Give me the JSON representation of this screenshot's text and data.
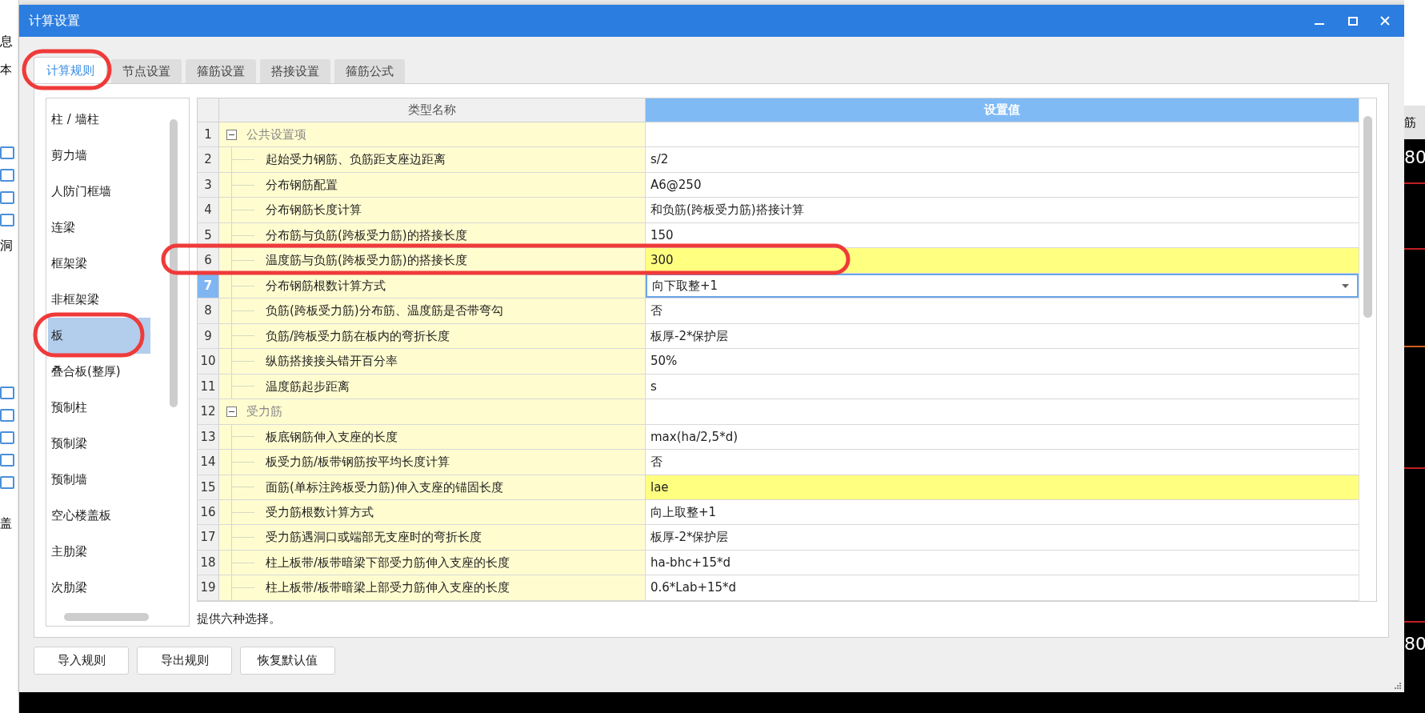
{
  "background": {
    "left_labels": [
      "息",
      "本",
      "洞",
      "盖"
    ],
    "right_labels": [
      "筋",
      "80",
      "80"
    ]
  },
  "window": {
    "title": "计算设置"
  },
  "tabs": [
    {
      "label": "计算规则",
      "selected": true
    },
    {
      "label": "节点设置",
      "selected": false
    },
    {
      "label": "箍筋设置",
      "selected": false
    },
    {
      "label": "搭接设置",
      "selected": false
    },
    {
      "label": "箍筋公式",
      "selected": false
    }
  ],
  "categories": [
    {
      "label": "柱 / 墙柱",
      "selected": false
    },
    {
      "label": "剪力墙",
      "selected": false
    },
    {
      "label": "人防门框墙",
      "selected": false
    },
    {
      "label": "连梁",
      "selected": false
    },
    {
      "label": "框架梁",
      "selected": false
    },
    {
      "label": "非框架梁",
      "selected": false
    },
    {
      "label": "板",
      "selected": true
    },
    {
      "label": "叠合板(整厚)",
      "selected": false
    },
    {
      "label": "预制柱",
      "selected": false
    },
    {
      "label": "预制梁",
      "selected": false
    },
    {
      "label": "预制墙",
      "selected": false
    },
    {
      "label": "空心楼盖板",
      "selected": false
    },
    {
      "label": "主肋梁",
      "selected": false
    },
    {
      "label": "次肋梁",
      "selected": false
    }
  ],
  "table": {
    "columns": [
      "类型名称",
      "设置值"
    ],
    "rows": [
      {
        "num": "1",
        "kind": "group",
        "name": "公共设置项",
        "expanded": true
      },
      {
        "num": "2",
        "kind": "item",
        "name": "起始受力钢筋、负筋距支座边距离",
        "value": "s/2",
        "highlighted": false,
        "selected": false
      },
      {
        "num": "3",
        "kind": "item",
        "name": "分布钢筋配置",
        "value": "A6@250",
        "highlighted": false,
        "selected": false
      },
      {
        "num": "4",
        "kind": "item",
        "name": "分布钢筋长度计算",
        "value": "和负筋(跨板受力筋)搭接计算",
        "highlighted": false,
        "selected": false
      },
      {
        "num": "5",
        "kind": "item",
        "name": "分布筋与负筋(跨板受力筋)的搭接长度",
        "value": "150",
        "highlighted": false,
        "selected": false
      },
      {
        "num": "6",
        "kind": "item",
        "name": "温度筋与负筋(跨板受力筋)的搭接长度",
        "value": "300",
        "highlighted": true,
        "selected": false
      },
      {
        "num": "7",
        "kind": "item",
        "name": "分布钢筋根数计算方式",
        "value": "向下取整+1",
        "highlighted": false,
        "selected": true
      },
      {
        "num": "8",
        "kind": "item",
        "name": "负筋(跨板受力筋)分布筋、温度筋是否带弯勾",
        "value": "否",
        "highlighted": false,
        "selected": false
      },
      {
        "num": "9",
        "kind": "item",
        "name": "负筋/跨板受力筋在板内的弯折长度",
        "value": "板厚-2*保护层",
        "highlighted": false,
        "selected": false
      },
      {
        "num": "10",
        "kind": "item",
        "name": "纵筋搭接接头错开百分率",
        "value": "50%",
        "highlighted": false,
        "selected": false
      },
      {
        "num": "11",
        "kind": "item",
        "name": "温度筋起步距离",
        "value": "s",
        "highlighted": false,
        "selected": false
      },
      {
        "num": "12",
        "kind": "group",
        "name": "受力筋",
        "expanded": true
      },
      {
        "num": "13",
        "kind": "item",
        "name": "板底钢筋伸入支座的长度",
        "value": "max(ha/2,5*d)",
        "highlighted": false,
        "selected": false
      },
      {
        "num": "14",
        "kind": "item",
        "name": "板受力筋/板带钢筋按平均长度计算",
        "value": "否",
        "highlighted": false,
        "selected": false
      },
      {
        "num": "15",
        "kind": "item",
        "name": "面筋(单标注跨板受力筋)伸入支座的锚固长度",
        "value": "lae",
        "highlighted": true,
        "selected": false
      },
      {
        "num": "16",
        "kind": "item",
        "name": "受力筋根数计算方式",
        "value": "向上取整+1",
        "highlighted": false,
        "selected": false
      },
      {
        "num": "17",
        "kind": "item",
        "name": "受力筋遇洞口或端部无支座时的弯折长度",
        "value": "板厚-2*保护层",
        "highlighted": false,
        "selected": false
      },
      {
        "num": "18",
        "kind": "item",
        "name": "柱上板带/板带暗梁下部受力筋伸入支座的长度",
        "value": "ha-bhc+15*d",
        "highlighted": false,
        "selected": false
      },
      {
        "num": "19",
        "kind": "item",
        "name": "柱上板带/板带暗梁上部受力筋伸入支座的长度",
        "value": "0.6*Lab+15*d",
        "highlighted": false,
        "selected": false
      }
    ]
  },
  "hint": "提供六种选择。",
  "buttons": [
    "导入规则",
    "导出规则",
    "恢复默认值"
  ]
}
